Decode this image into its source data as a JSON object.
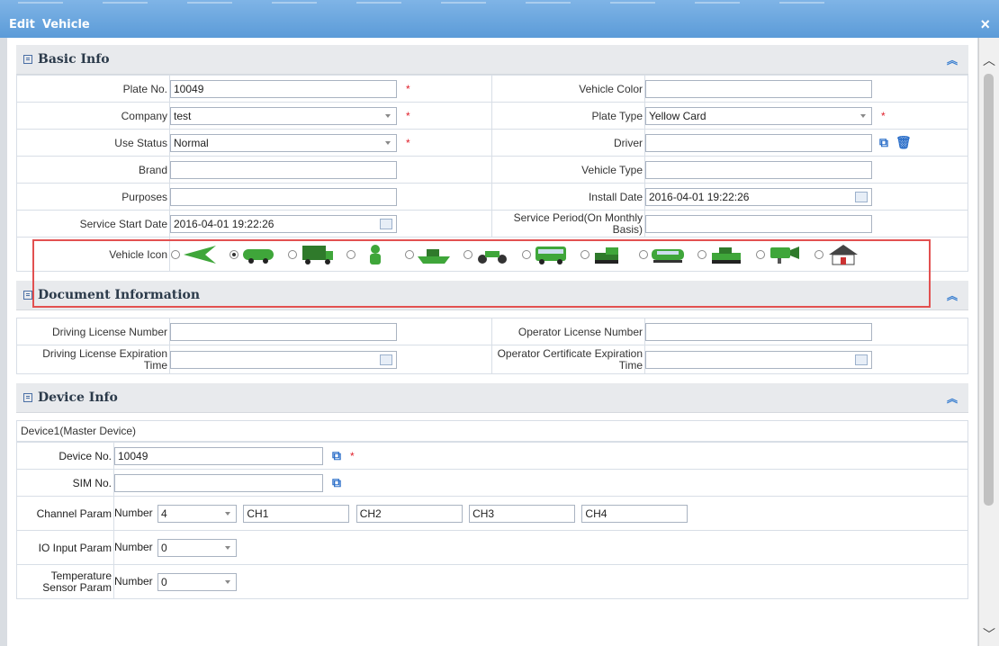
{
  "window": {
    "edit": "Edit",
    "object": "Vehicle",
    "close": "×"
  },
  "basic": {
    "title": "Basic Info",
    "plate_no_label": "Plate No.",
    "plate_no_value": "10049",
    "vehicle_color_label": "Vehicle Color",
    "vehicle_color_value": "",
    "company_label": "Company",
    "company_value": "test",
    "plate_type_label": "Plate Type",
    "plate_type_value": "Yellow Card",
    "use_status_label": "Use Status",
    "use_status_value": "Normal",
    "driver_label": "Driver",
    "driver_value": "",
    "brand_label": "Brand",
    "brand_value": "",
    "vehicle_type_label": "Vehicle Type",
    "vehicle_type_value": "",
    "purposes_label": "Purposes",
    "purposes_value": "",
    "install_date_label": "Install Date",
    "install_date_value": "2016-04-01 19:22:26",
    "service_start_label": "Service Start Date",
    "service_start_value": "2016-04-01 19:22:26",
    "service_period_label": "Service Period(On Monthly Basis)",
    "service_period_value": "",
    "vehicle_icon_label": "Vehicle Icon",
    "vehicle_icons": [
      "arrow-icon",
      "car-icon",
      "truck-icon",
      "person-icon",
      "boat-icon",
      "motorcycle-icon",
      "bus-icon",
      "excavator-icon",
      "train-icon",
      "tank-icon",
      "camera-icon",
      "house-icon"
    ],
    "selected_icon_index": 1,
    "required_mark": "*"
  },
  "document": {
    "title": "Document Information",
    "dl_number_label": "Driving License Number",
    "dl_number_value": "",
    "op_license_label": "Operator License Number",
    "op_license_value": "",
    "dl_expiry_label": "Driving License Expiration Time",
    "dl_expiry_value": "",
    "op_cert_expiry_label": "Operator Certificate Expiration Time",
    "op_cert_expiry_value": ""
  },
  "device": {
    "title": "Device Info",
    "device1_header": "Device1(Master Device)",
    "device_no_label": "Device No.",
    "device_no_value": "10049",
    "sim_no_label": "SIM No.",
    "sim_no_value": "",
    "channel_label": "Channel Param",
    "number_label": "Number",
    "channel_count": "4",
    "channels": [
      "CH1",
      "CH2",
      "CH3",
      "CH4"
    ],
    "io_label": "IO Input Param",
    "io_count": "0",
    "temp_label": "Temperature Sensor Param",
    "temp_count": "0"
  },
  "colors": {
    "titlebar": "#5b9bd8",
    "required": "#e0202b",
    "highlight_box": "#e25050",
    "accent": "#2c6fc9"
  }
}
